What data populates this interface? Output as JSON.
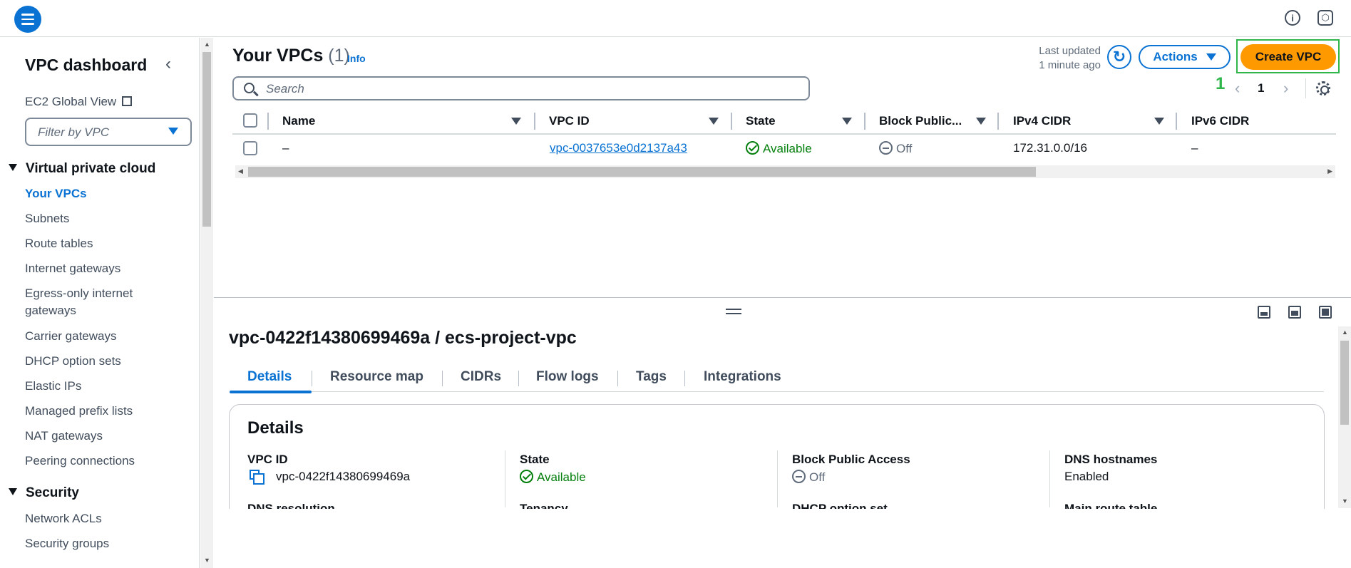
{
  "sidebar": {
    "title": "VPC dashboard",
    "global_view": "EC2 Global View",
    "filter_placeholder": "Filter by VPC",
    "sections": [
      {
        "label": "Virtual private cloud",
        "items": [
          "Your VPCs",
          "Subnets",
          "Route tables",
          "Internet gateways",
          "Egress-only internet",
          "gateways",
          "Carrier gateways",
          "DHCP option sets",
          "Elastic IPs",
          "Managed prefix lists",
          "NAT gateways",
          "Peering connections"
        ]
      },
      {
        "label": "Security",
        "items": [
          "Network ACLs",
          "Security groups"
        ]
      }
    ]
  },
  "main": {
    "title": "Your VPCs",
    "count": "(1)",
    "info": "Info",
    "last_updated_label": "Last updated",
    "last_updated_value": "1 minute ago",
    "actions_label": "Actions",
    "create_label": "Create VPC",
    "step_marker": "1",
    "search_placeholder": "Search",
    "page_number": "1",
    "columns": [
      "Name",
      "VPC ID",
      "State",
      "Block Public...",
      "IPv4 CIDR",
      "IPv6 CIDR"
    ],
    "rows": [
      {
        "name": "–",
        "vpc_id": "vpc-0037653e0d2137a43",
        "state": "Available",
        "block_public": "Off",
        "ipv4": "172.31.0.0/16",
        "ipv6": "–"
      }
    ]
  },
  "detail": {
    "title": "vpc-0422f14380699469a / ecs-project-vpc",
    "tabs": [
      "Details",
      "Resource map",
      "CIDRs",
      "Flow logs",
      "Tags",
      "Integrations"
    ],
    "card_title": "Details",
    "fields": [
      {
        "label": "VPC ID",
        "value": "vpc-0422f14380699469a"
      },
      {
        "label": "State",
        "value": "Available"
      },
      {
        "label": "Block Public Access",
        "value": "Off"
      },
      {
        "label": "DNS hostnames",
        "value": "Enabled"
      }
    ],
    "next_fields": [
      "DNS resolution",
      "Tenancy",
      "DHCP option set",
      "Main route table"
    ]
  },
  "colors": {
    "accent": "#0972d3",
    "primary_button": "#ff9900",
    "success": "#037f0c",
    "highlight": "#2fb54a"
  }
}
